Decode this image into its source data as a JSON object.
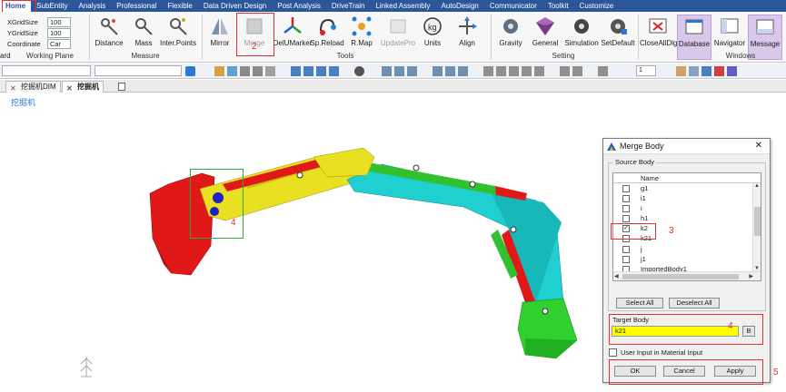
{
  "menubar": {
    "items": [
      "Home",
      "SubEntity",
      "Analysis",
      "Professional",
      "Flexible",
      "Data Driven Design",
      "Post Analysis",
      "DriveTrain",
      "Linked Assembly",
      "AutoDesign",
      "Communicator",
      "Toolkit",
      "Customize"
    ]
  },
  "working_plane": {
    "xgrid_label": "XGridSize",
    "xgrid_value": "100",
    "ygrid_label": "YGridSize",
    "ygrid_value": "100",
    "coord_label": "Coordinate",
    "coord_value": "Car",
    "group_label": "Working Plane",
    "left_cut_label": "ard"
  },
  "ribbon": {
    "measure": [
      "Distance",
      "Mass",
      "Inter.Points"
    ],
    "measure_group": "Measure",
    "tools": [
      "Mirror",
      "Merge",
      "DelUMarker",
      "Sp.Reload",
      "R.Map",
      "UpdatePro",
      "Units",
      "Align"
    ],
    "tools_group": "Tools",
    "setting": [
      "Gravity",
      "General",
      "Simulation",
      "SetDefault"
    ],
    "setting_group": "Setting",
    "windows": [
      "CloseAllDlg",
      "Database",
      "Navigator",
      "Message"
    ],
    "windows_group": "Windows"
  },
  "toolbar2": {
    "page_value": "1"
  },
  "tabs": {
    "tab1": "挖掘机DIM",
    "tab2": "挖掘机"
  },
  "viewport": {
    "model_title": "挖掘机"
  },
  "dialog": {
    "title": "Merge Body",
    "source_label": "Source Body",
    "name_header": "Name",
    "rows": [
      {
        "name": "g1",
        "checked": false
      },
      {
        "name": "i1",
        "checked": false
      },
      {
        "name": "i",
        "checked": false
      },
      {
        "name": "h1",
        "checked": false
      },
      {
        "name": "k2",
        "checked": true
      },
      {
        "name": "k21",
        "checked": false
      },
      {
        "name": "j",
        "checked": false
      },
      {
        "name": "j1",
        "checked": false
      },
      {
        "name": "ImportedBody1",
        "checked": false
      }
    ],
    "select_all": "Select All",
    "deselect_all": "Deselect All",
    "target_label": "Target Body",
    "target_value": "k21",
    "target_button": "B",
    "user_input_label": "User Input in Material Input",
    "ok": "OK",
    "cancel": "Cancel",
    "apply": "Apply"
  },
  "annotations": {
    "n2": "2",
    "n3": "3",
    "n4a": "4",
    "n4b": "4",
    "n5": "5"
  },
  "colors": {
    "menubar": "#2b579a",
    "target_highlight": "#ffff00",
    "annotation_red": "#e03030",
    "annotation_green": "#2fa83a"
  }
}
